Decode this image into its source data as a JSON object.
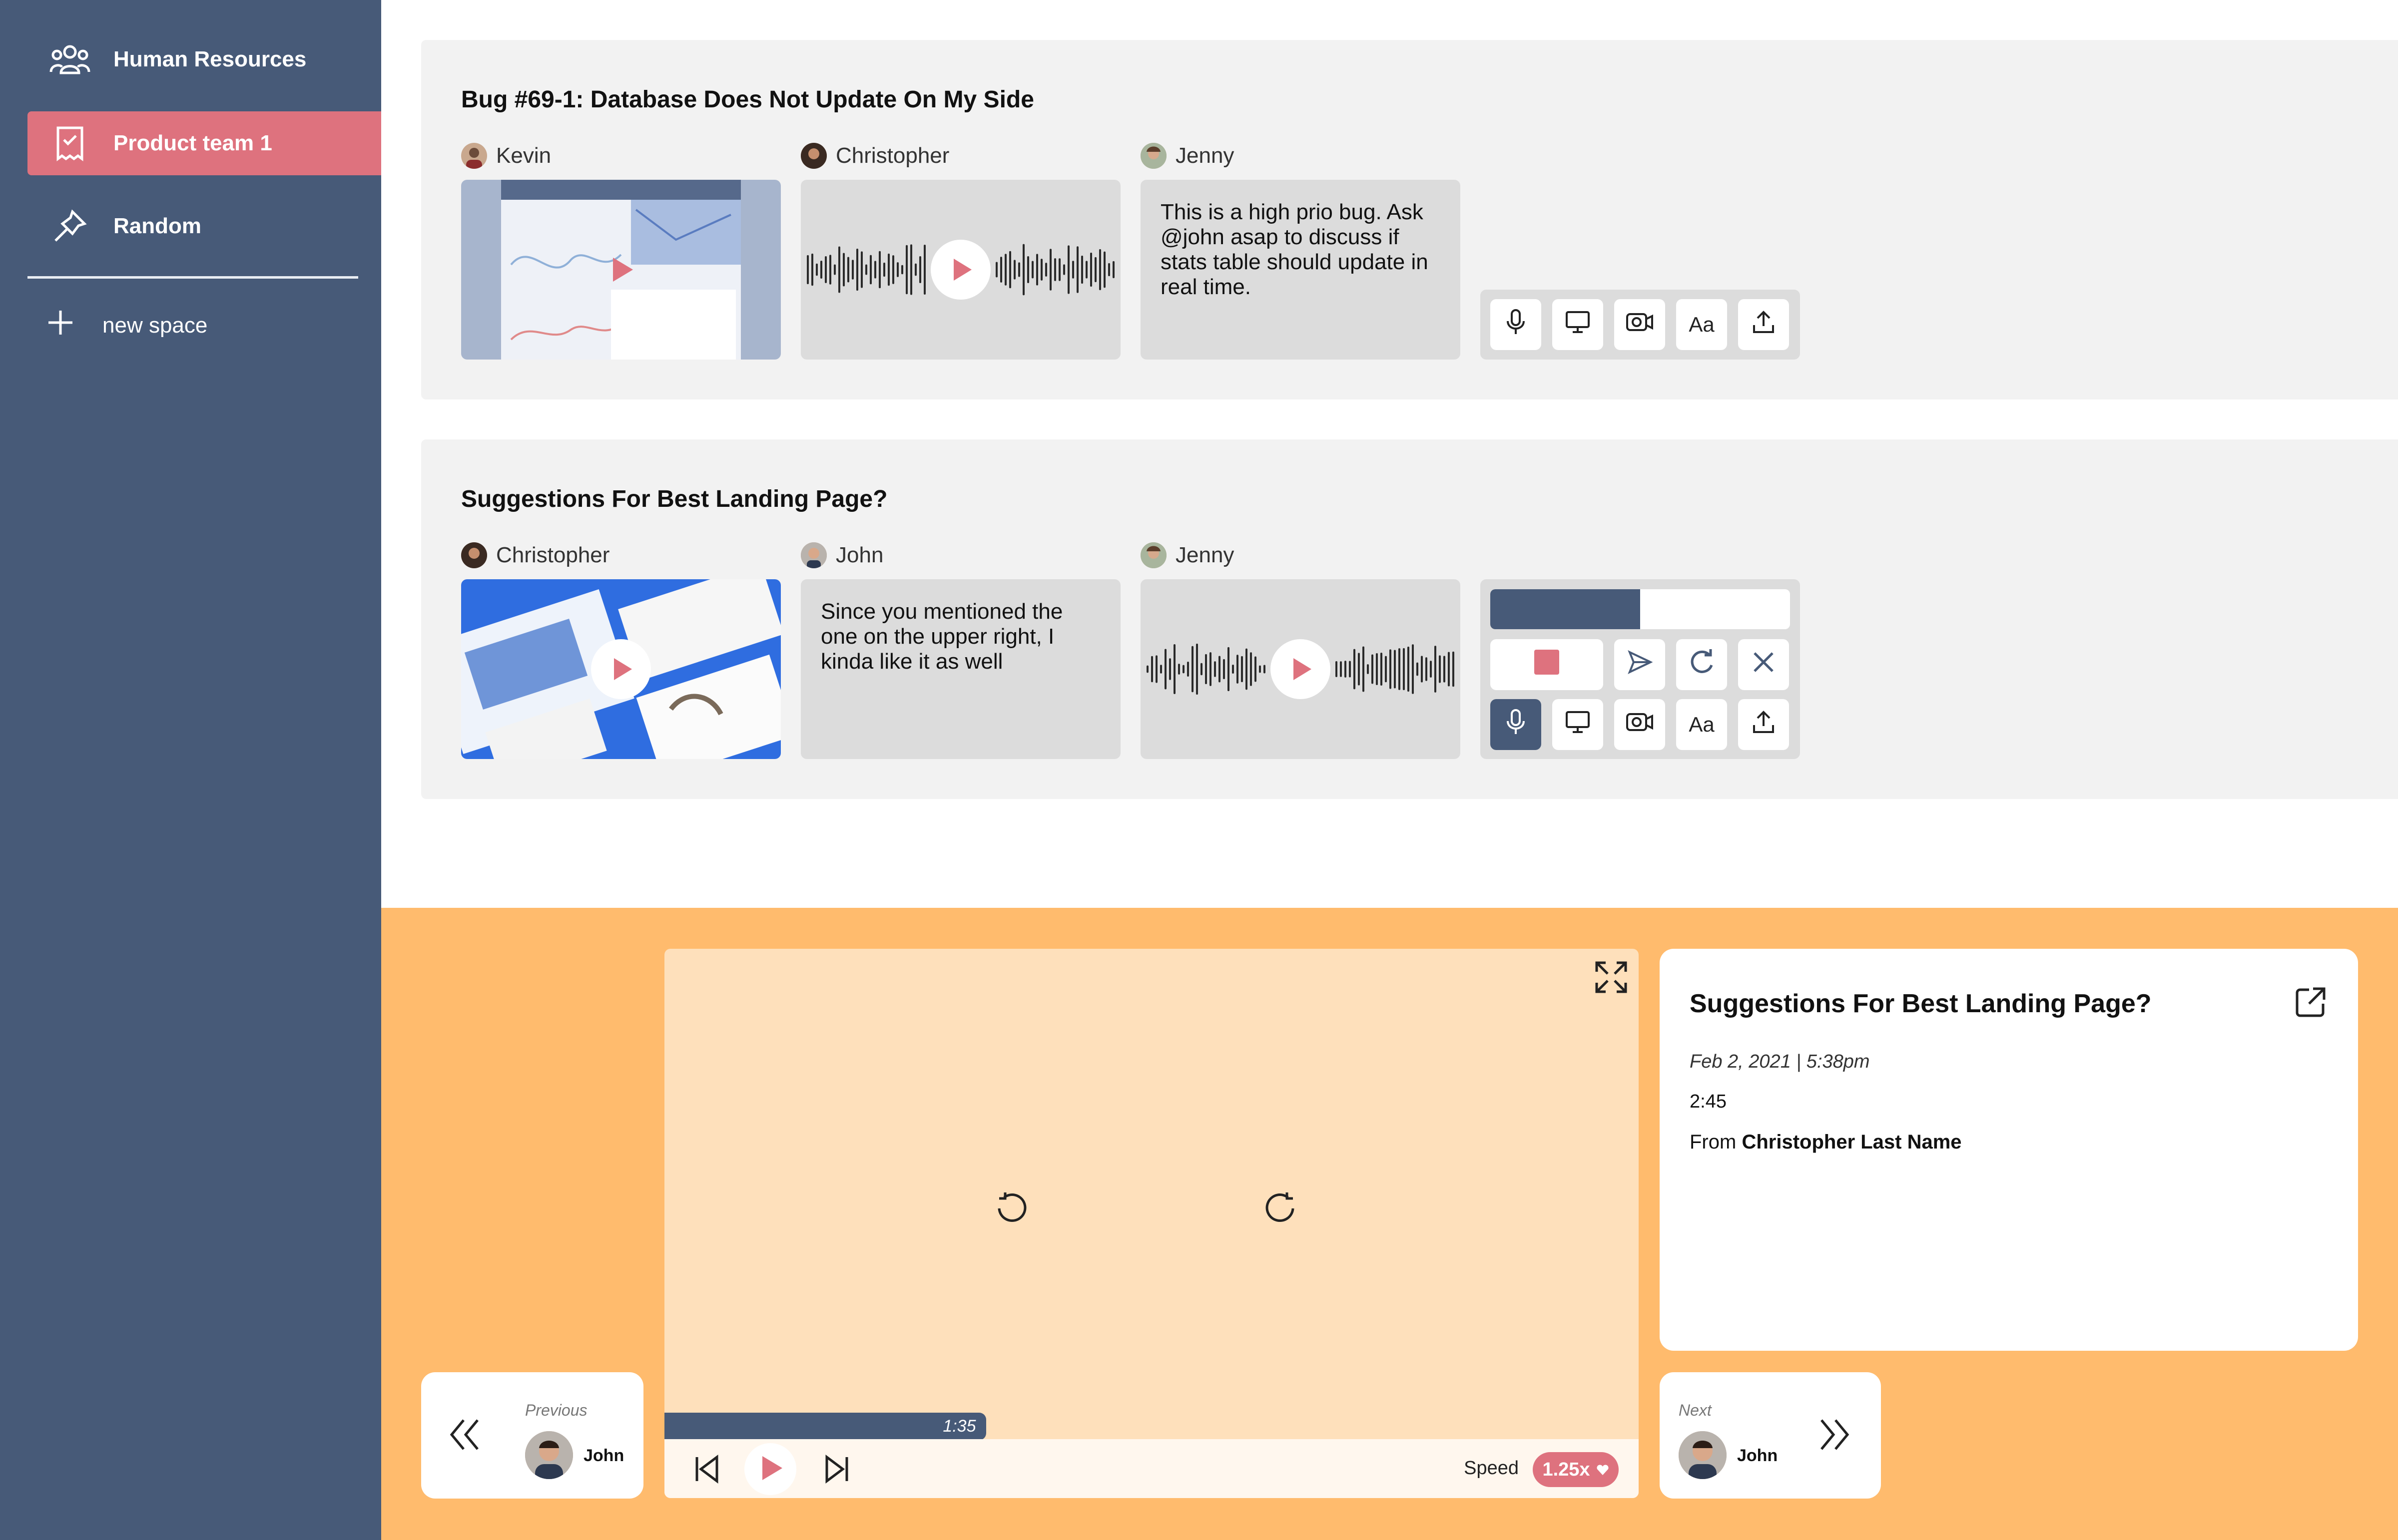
{
  "sidebar": {
    "items": [
      {
        "label": "Human Resources",
        "icon": "people-icon"
      },
      {
        "label": "Product team 1",
        "icon": "clipboard-check-icon",
        "active": true
      },
      {
        "label": "Random",
        "icon": "pin-icon"
      }
    ],
    "new_space_label": "new space",
    "colors": {
      "background": "#475a78",
      "active": "#de727e"
    }
  },
  "threads": [
    {
      "title": "Bug #69-1: Database Does Not Update On My Side",
      "messages": [
        {
          "author": "Kevin",
          "type": "video"
        },
        {
          "author": "Christopher",
          "type": "audio"
        },
        {
          "author": "Jenny",
          "type": "text",
          "text": "This is a high prio bug. Ask @john asap to discuss if stats table should update in real time."
        }
      ],
      "composer": {
        "tools": [
          "mic-icon",
          "screen-icon",
          "camera-icon",
          "Aa",
          "upload-icon"
        ]
      }
    },
    {
      "title": "Suggestions For Best Landing Page?",
      "messages": [
        {
          "author": "Christopher",
          "type": "video"
        },
        {
          "author": "John",
          "type": "text",
          "text": "Since you mentioned the one on the upper right, I kinda like it as well"
        },
        {
          "author": "Jenny",
          "type": "audio"
        }
      ],
      "composer": {
        "recording_progress": 0.5,
        "actions": [
          "stop-icon",
          "send-icon",
          "redo-icon",
          "close-icon"
        ],
        "tools": [
          "mic-icon",
          "screen-icon",
          "camera-icon",
          "Aa",
          "upload-icon"
        ],
        "active_tool": "mic-icon"
      }
    }
  ],
  "player": {
    "elapsed": "1:35",
    "progress_fraction": 0.33,
    "speed_label": "Speed",
    "speed_value": "1.25x",
    "accent": "#de727e",
    "background": "#ffbb6d"
  },
  "details": {
    "title": "Suggestions For Best Landing Page?",
    "date": "Feb 2, 2021 | 5:38pm",
    "duration": "2:45",
    "from_label": "From",
    "from_name": "Christopher Last Name"
  },
  "navigation": {
    "previous": {
      "caption": "Previous",
      "name": "John"
    },
    "next": {
      "caption": "Next",
      "name": "John"
    }
  }
}
